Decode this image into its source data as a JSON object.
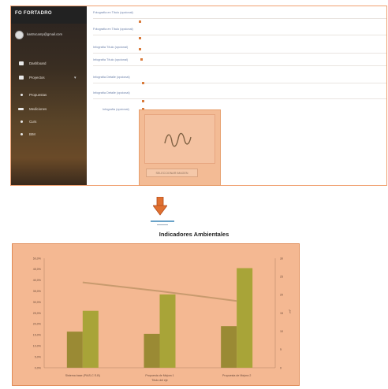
{
  "app": {
    "brand": "FO FORTADRO",
    "user_email": "kastrocamp@gmail.com",
    "nav": [
      {
        "label": "Dashboard",
        "icon": "dashboard-icon"
      },
      {
        "label": "Proyectos",
        "icon": "folder-icon",
        "expandable": true
      },
      {
        "label": "Propuestas",
        "icon": "dot-icon"
      },
      {
        "label": "Mediciones",
        "icon": "measure-icon"
      },
      {
        "label": "Curs",
        "icon": "dot-icon"
      },
      {
        "label": "BIM",
        "icon": "bim-icon"
      }
    ],
    "fields": [
      {
        "label": "Fotografía en Título (opcional)"
      },
      {
        "label": "Fotografía en Título (opcional)"
      },
      {
        "label": "Infografía Título (opcional)"
      },
      {
        "label": "Infografía Título (opcional)"
      },
      {
        "label": "Infografía Detalle (opcional)"
      },
      {
        "label": "Infografía Detalle (opcional)"
      },
      {
        "label": "Infografía (opcional)"
      }
    ],
    "upload_button": "SELECCIONAR IMAGEN",
    "accent": "#d97a3a"
  },
  "chart_data": {
    "type": "bar",
    "title": "Indicadores Ambientales",
    "xlabel": "Título del eje",
    "ylabel_right": "m²",
    "categories": [
      "Sistema base (PIAS-C E-B)",
      "Propuesta de Mejora 1",
      "Propuesta de Mejora 2"
    ],
    "y_left_ticks": [
      "0,0%",
      "5,0%",
      "10,0%",
      "15,0%",
      "20,0%",
      "25,0%",
      "30,0%",
      "35,0%",
      "40,0%",
      "45,0%",
      "50,0%"
    ],
    "y_right_ticks": [
      "0",
      "5",
      "10",
      "15",
      "20",
      "25",
      "30"
    ],
    "ylim_left": [
      0,
      50
    ],
    "ylim_right": [
      0,
      30
    ],
    "series": [
      {
        "values": [
          16.5,
          15.5,
          19
        ],
        "color": "#9a8a34"
      },
      {
        "values": [
          26,
          33.5,
          45.5
        ],
        "color": "#a8a438"
      },
      {
        "values": [
          39,
          35,
          30.5
        ],
        "color": "#c89a6e"
      }
    ]
  }
}
